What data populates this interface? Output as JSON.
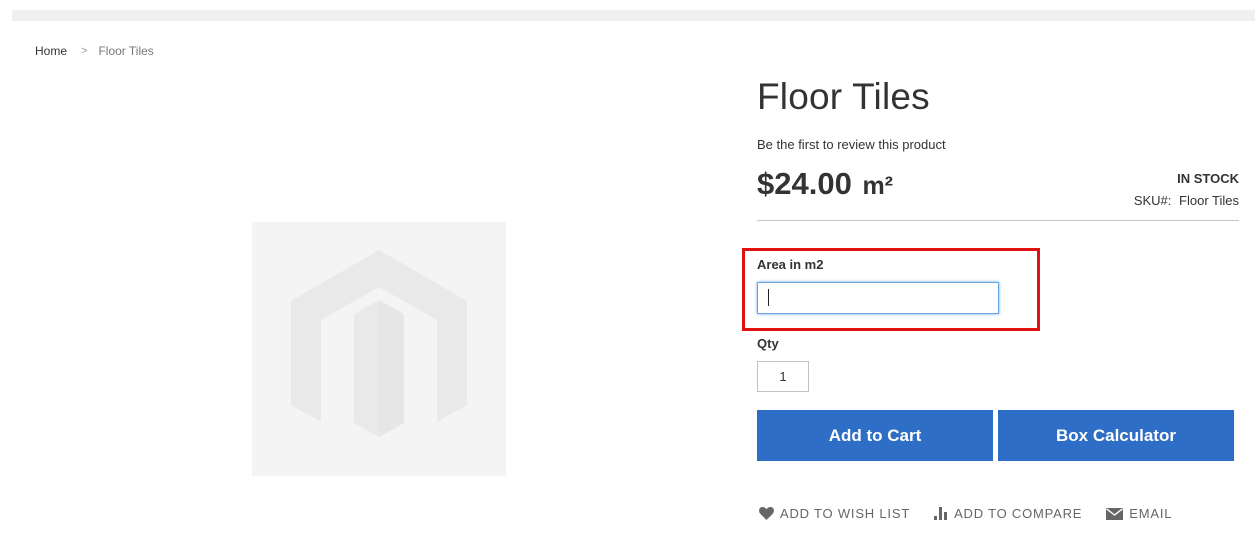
{
  "breadcrumb": {
    "home": "Home",
    "separator": ">",
    "current": "Floor Tiles"
  },
  "product": {
    "title": "Floor Tiles",
    "review_link": "Be the first to review this product",
    "price": "$24.00",
    "price_unit": "m²",
    "stock_status": "IN STOCK",
    "sku_label": "SKU#:",
    "sku_value": "Floor Tiles",
    "image_icon": "magento-logo-placeholder"
  },
  "form": {
    "area_label": "Area in m2",
    "area_value": "",
    "qty_label": "Qty",
    "qty_value": "1"
  },
  "buttons": {
    "add_to_cart": "Add to Cart",
    "box_calculator": "Box Calculator"
  },
  "actions": {
    "wishlist": "ADD TO WISH LIST",
    "compare": "ADD TO COMPARE",
    "email": "EMAIL"
  },
  "colors": {
    "primary_button": "#2f6ec6",
    "highlight_border": "#e01111",
    "input_focus": "#6aa5e0",
    "placeholder_bg": "#f4f4f4"
  }
}
